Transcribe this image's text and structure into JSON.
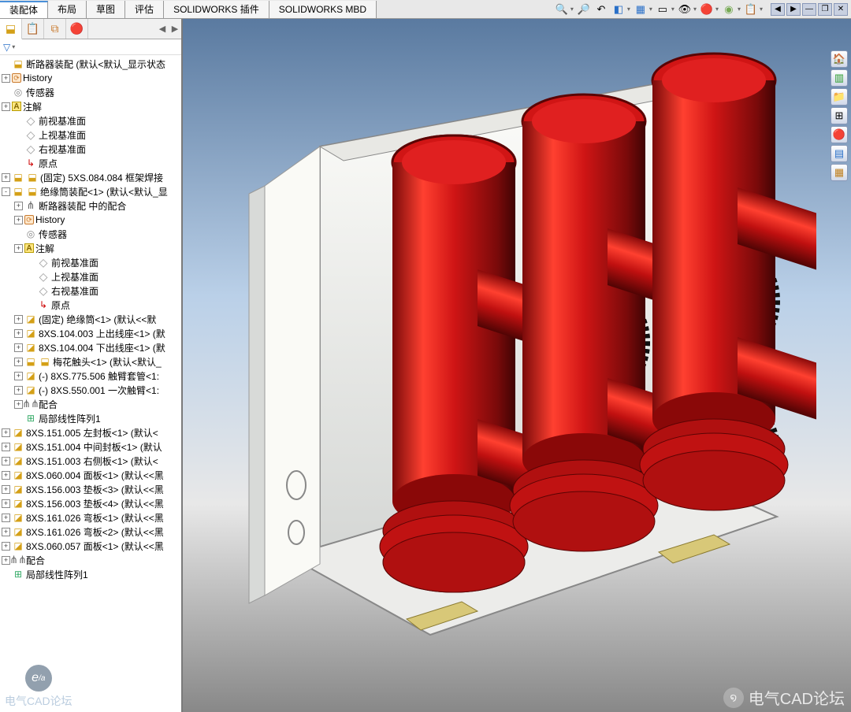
{
  "tabs": {
    "items": [
      "装配体",
      "布局",
      "草图",
      "评估",
      "SOLIDWORKS 插件",
      "SOLIDWORKS MBD"
    ],
    "active": 0
  },
  "hud": {
    "icons": [
      "zoom-fit",
      "zoom-area",
      "zoom-prev",
      "section",
      "view-orient",
      "display-style",
      "hide-show",
      "edit-appear",
      "apply-scene",
      "view-settings"
    ]
  },
  "window_controls": [
    "span-left",
    "span-right",
    "minimize",
    "restore",
    "close"
  ],
  "tree": {
    "root": "断路器装配  (默认<默认_显示状态",
    "items": [
      {
        "d": 0,
        "exp": "",
        "ic": "assy",
        "lbl": "断路器装配  (默认<默认_显示状态"
      },
      {
        "d": 0,
        "exp": "+",
        "ic": "hist",
        "lbl": "History"
      },
      {
        "d": 0,
        "exp": "",
        "ic": "sensor",
        "lbl": "传感器"
      },
      {
        "d": 0,
        "exp": "+",
        "ic": "annot",
        "lbl": "注解"
      },
      {
        "d": 1,
        "exp": "",
        "ic": "plane",
        "lbl": "前视基准面"
      },
      {
        "d": 1,
        "exp": "",
        "ic": "plane",
        "lbl": "上视基准面"
      },
      {
        "d": 1,
        "exp": "",
        "ic": "plane",
        "lbl": "右视基准面"
      },
      {
        "d": 1,
        "exp": "",
        "ic": "origin",
        "lbl": "原点"
      },
      {
        "d": 0,
        "exp": "+",
        "ic": "assy2",
        "lbl": "(固定) 5XS.084.084 框架焊接"
      },
      {
        "d": 0,
        "exp": "-",
        "ic": "assy2",
        "lbl": "绝缘筒装配<1> (默认<默认_显"
      },
      {
        "d": 1,
        "exp": "+",
        "ic": "mate2",
        "lbl": "断路器装配 中的配合"
      },
      {
        "d": 1,
        "exp": "+",
        "ic": "hist",
        "lbl": "History"
      },
      {
        "d": 1,
        "exp": "",
        "ic": "sensor",
        "lbl": "传感器"
      },
      {
        "d": 1,
        "exp": "+",
        "ic": "annot",
        "lbl": "注解"
      },
      {
        "d": 2,
        "exp": "",
        "ic": "plane",
        "lbl": "前视基准面"
      },
      {
        "d": 2,
        "exp": "",
        "ic": "plane",
        "lbl": "上视基准面"
      },
      {
        "d": 2,
        "exp": "",
        "ic": "plane",
        "lbl": "右视基准面"
      },
      {
        "d": 2,
        "exp": "",
        "ic": "origin",
        "lbl": "原点"
      },
      {
        "d": 1,
        "exp": "+",
        "ic": "part",
        "lbl": "(固定) 绝缘筒<1> (默认<<默"
      },
      {
        "d": 1,
        "exp": "+",
        "ic": "part",
        "lbl": "8XS.104.003 上出线座<1> (默"
      },
      {
        "d": 1,
        "exp": "+",
        "ic": "part",
        "lbl": "8XS.104.004 下出线座<1> (默"
      },
      {
        "d": 1,
        "exp": "+",
        "ic": "assy2",
        "lbl": "梅花触头<1> (默认<默认_"
      },
      {
        "d": 1,
        "exp": "+",
        "ic": "part",
        "lbl": "(-) 8XS.775.506 触臂套管<1:"
      },
      {
        "d": 1,
        "exp": "+",
        "ic": "part",
        "lbl": "(-) 8XS.550.001 一次触臂<1:"
      },
      {
        "d": 1,
        "exp": "+",
        "ic": "mate",
        "lbl": "配合"
      },
      {
        "d": 1,
        "exp": "",
        "ic": "pattern",
        "lbl": "局部线性阵列1"
      },
      {
        "d": 0,
        "exp": "+",
        "ic": "part",
        "lbl": "8XS.151.005 左封板<1> (默认<"
      },
      {
        "d": 0,
        "exp": "+",
        "ic": "part",
        "lbl": "8XS.151.004 中间封板<1> (默认"
      },
      {
        "d": 0,
        "exp": "+",
        "ic": "part",
        "lbl": "8XS.151.003 右侧板<1> (默认<"
      },
      {
        "d": 0,
        "exp": "+",
        "ic": "part",
        "lbl": "8XS.060.004 面板<1> (默认<<黑"
      },
      {
        "d": 0,
        "exp": "+",
        "ic": "part",
        "lbl": "8XS.156.003 垫板<3> (默认<<黑"
      },
      {
        "d": 0,
        "exp": "+",
        "ic": "part",
        "lbl": "8XS.156.003 垫板<4> (默认<<黑"
      },
      {
        "d": 0,
        "exp": "+",
        "ic": "part",
        "lbl": "8XS.161.026 弯板<1> (默认<<黑"
      },
      {
        "d": 0,
        "exp": "+",
        "ic": "part",
        "lbl": "8XS.161.026 弯板<2> (默认<<黑"
      },
      {
        "d": 0,
        "exp": "+",
        "ic": "part",
        "lbl": "8XS.060.057 面板<1> (默认<<黑"
      },
      {
        "d": 0,
        "exp": "+",
        "ic": "mate",
        "lbl": "配合"
      },
      {
        "d": 0,
        "exp": "",
        "ic": "pattern",
        "lbl": "局部线性阵列1"
      }
    ]
  },
  "watermark": {
    "right": "电气CAD论坛",
    "left": "电气CAD论坛"
  },
  "right_tools": [
    "home",
    "volume",
    "folder",
    "dims",
    "colors",
    "grid",
    "info"
  ],
  "colors": {
    "red": "#d01515",
    "redDark": "#8a0808",
    "metal": "#f4f4f0",
    "metalDark": "#b8baba"
  }
}
